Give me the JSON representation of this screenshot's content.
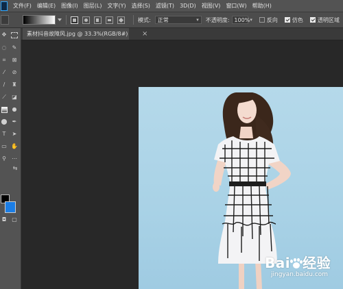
{
  "menubar": {
    "items": [
      "文件(F)",
      "编辑(E)",
      "图像(I)",
      "图层(L)",
      "文字(Y)",
      "选择(S)",
      "滤镜(T)",
      "3D(D)",
      "视图(V)",
      "窗口(W)",
      "帮助(H)"
    ]
  },
  "options": {
    "mode_label": "模式:",
    "mode_value": "正常",
    "opacity_label": "不透明度:",
    "opacity_value": "100%",
    "reverse_label": "反向",
    "reverse_checked": false,
    "dither_label": "仿色",
    "dither_checked": true,
    "transparency_label": "透明区域",
    "transparency_checked": true
  },
  "document": {
    "tab_title": "素材抖音故障风.jpg @ 33.3%(RGB/8#)",
    "close_glyph": "×"
  },
  "tools": {
    "foreground_color": "#000000",
    "background_color": "#1b7de4"
  },
  "photo": {
    "background_color": "#a9d2e6"
  },
  "watermark": {
    "brand_a": "Bai",
    "brand_b": "经验",
    "url": "jingyan.baidu.com"
  }
}
